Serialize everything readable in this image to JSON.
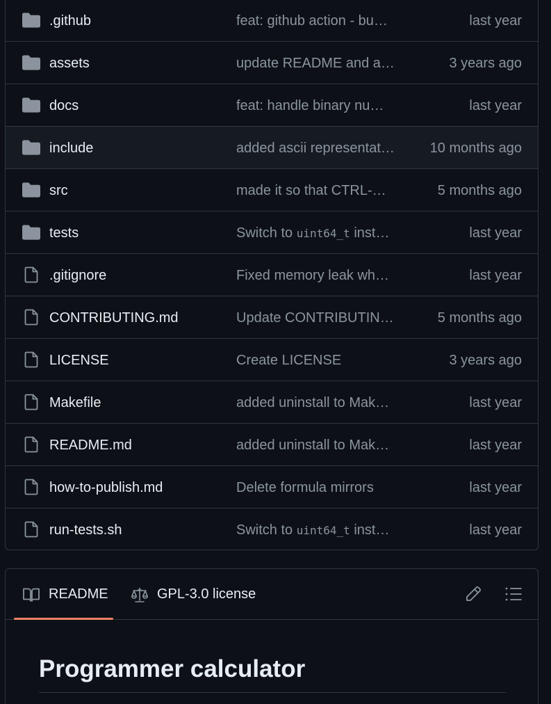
{
  "files": [
    {
      "type": "folder",
      "name": ".github",
      "message": "feat: github action - bu…",
      "age": "last year"
    },
    {
      "type": "folder",
      "name": "assets",
      "message": "update README and a…",
      "age": "3 years ago"
    },
    {
      "type": "folder",
      "name": "docs",
      "message": "feat: handle binary nu…",
      "age": "last year"
    },
    {
      "type": "folder",
      "name": "include",
      "message": "added ascii representat…",
      "age": "10 months ago"
    },
    {
      "type": "folder",
      "name": "src",
      "message": "made it so that CTRL-…",
      "age": "5 months ago"
    },
    {
      "type": "folder",
      "name": "tests",
      "message_prefix": "Switch to ",
      "message_code": "uint64_t",
      "message_suffix": " inst…",
      "age": "last year"
    },
    {
      "type": "file",
      "name": ".gitignore",
      "message": "Fixed memory leak wh…",
      "age": "last year"
    },
    {
      "type": "file",
      "name": "CONTRIBUTING.md",
      "message": "Update CONTRIBUTIN…",
      "age": "5 months ago"
    },
    {
      "type": "file",
      "name": "LICENSE",
      "message": "Create LICENSE",
      "age": "3 years ago"
    },
    {
      "type": "file",
      "name": "Makefile",
      "message": "added uninstall to Mak…",
      "age": "last year"
    },
    {
      "type": "file",
      "name": "README.md",
      "message": "added uninstall to Mak…",
      "age": "last year"
    },
    {
      "type": "file",
      "name": "how-to-publish.md",
      "message": "Delete formula mirrors",
      "age": "last year"
    },
    {
      "type": "file",
      "name": "run-tests.sh",
      "message_prefix": "Switch to ",
      "message_code": "uint64_t",
      "message_suffix": " inst…",
      "age": "last year"
    }
  ],
  "readme": {
    "tabs": {
      "readme_label": "README",
      "license_label": "GPL-3.0 license"
    },
    "title": "Programmer calculator"
  },
  "icons": {
    "folder": "folder-icon",
    "file": "file-icon",
    "book": "book-icon",
    "law": "law-icon",
    "pencil": "pencil-icon",
    "list": "list-unordered-icon"
  },
  "colors": {
    "background": "#0d1117",
    "border": "#30363d",
    "text": "#e6edf3",
    "muted": "#8b949e",
    "accent": "#f78166"
  }
}
